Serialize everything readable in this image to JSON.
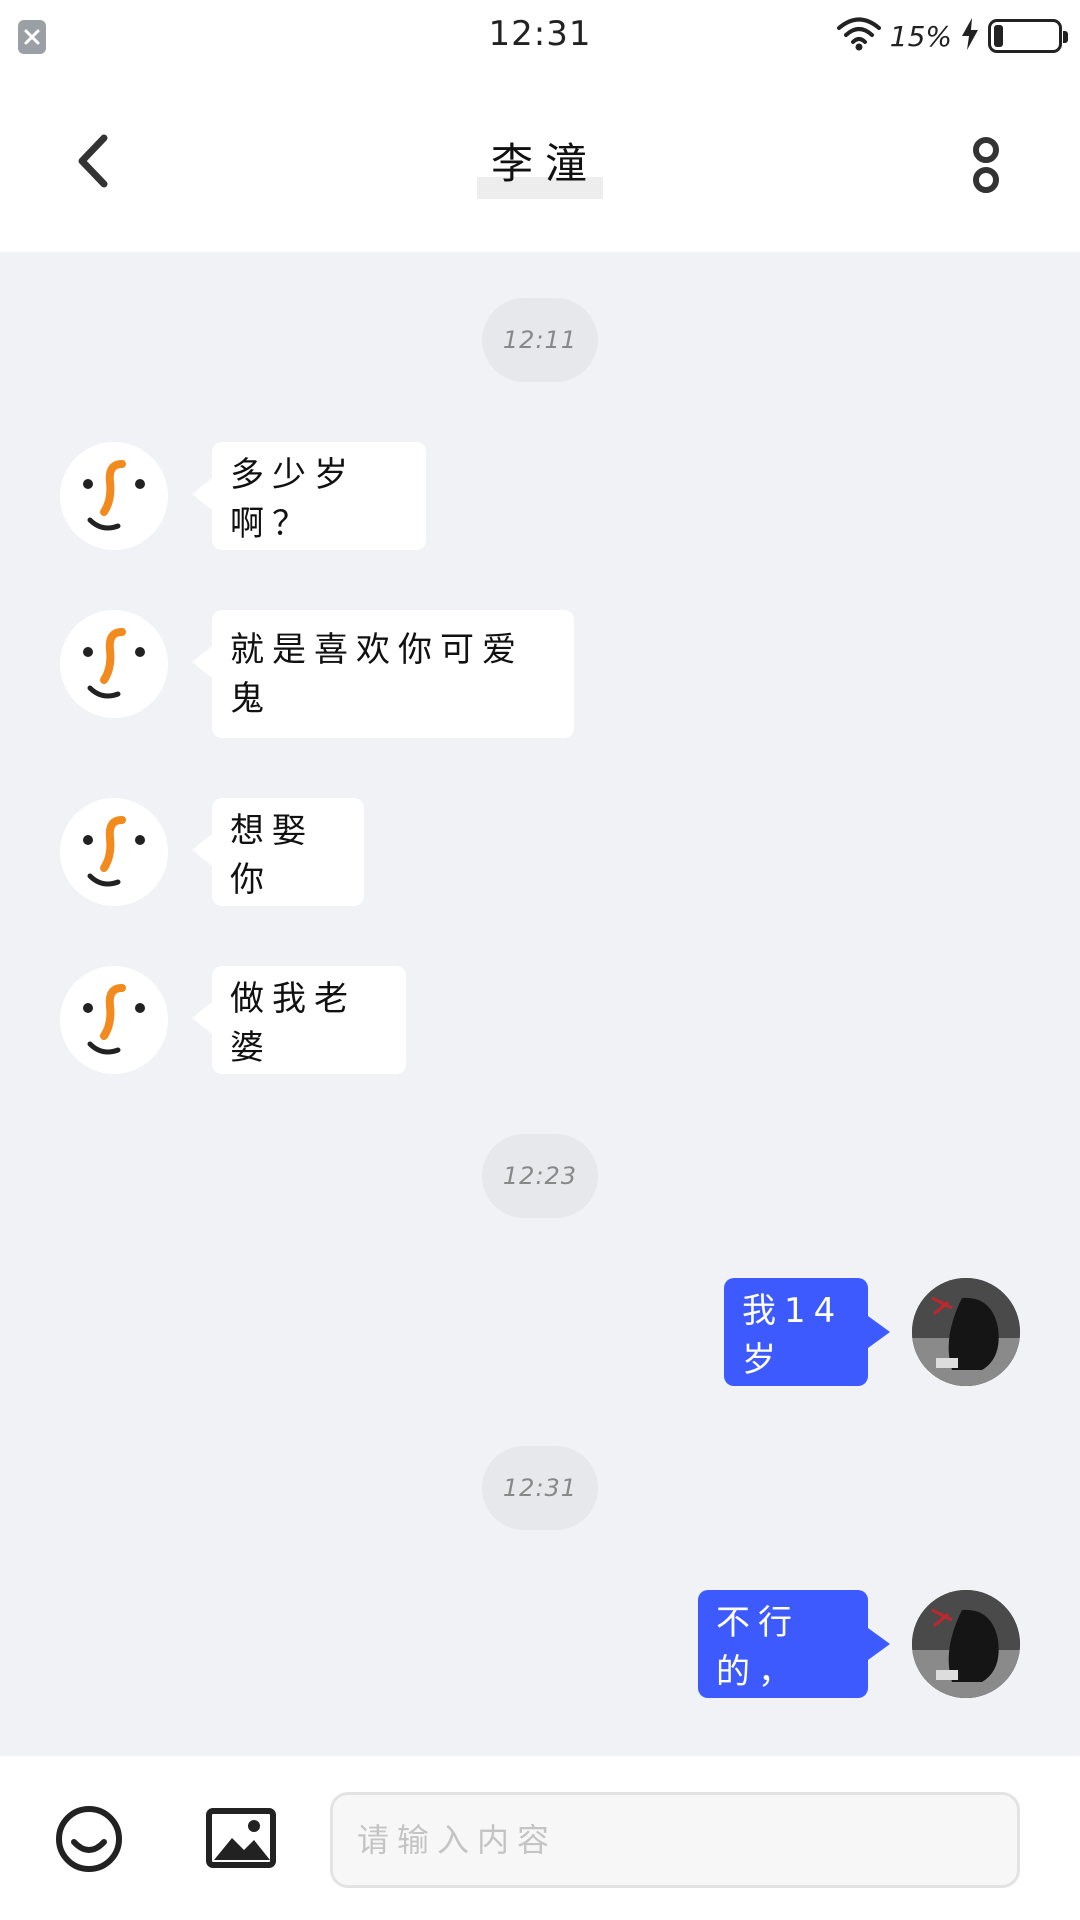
{
  "status_bar": {
    "time": "12:31",
    "battery_text": "15%",
    "battery_level": 0.15,
    "icons": [
      "app-notification-icon",
      "wifi-icon",
      "charging-icon",
      "battery-icon"
    ]
  },
  "header": {
    "title": "李潼",
    "icons": [
      "back-arrow-icon",
      "more-options-icon"
    ]
  },
  "messages": {
    "time_1": "12:11",
    "m1": "多少岁啊？",
    "m2": "就是喜欢你可爱鬼",
    "m3": "想娶你",
    "m4": "做我老婆",
    "time_2": "12:23",
    "m5": "我14岁",
    "time_3": "12:31",
    "m6": "不行的，"
  },
  "input_bar": {
    "placeholder": "请输入内容",
    "icons": [
      "emoji-icon",
      "image-icon"
    ]
  },
  "colors": {
    "accent": "#3d5afe",
    "chat_background": "#f0f2f5",
    "avatar_orange": "#f28a1e"
  }
}
